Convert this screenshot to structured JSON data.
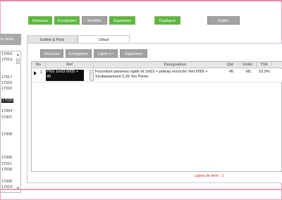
{
  "toolbar": {
    "new_label": "Nouveau",
    "save_label": "Enregistrer",
    "modify_label": "Modifier",
    "delete_label": "Supprimer",
    "duplicate_label": "Dupliquer",
    "edit_label": "Editer"
  },
  "left_panel": {
    "header": "lo devis",
    "items": [
      {
        "label": "17016"
      },
      {
        "label": "17013"
      },
      {
        "label": "17017"
      },
      {
        "label": "17015"
      },
      {
        "label": "17010"
      },
      {
        "label": "17025"
      },
      {
        "label": "17004"
      },
      {
        "label": "17007"
      },
      {
        "label": "17008"
      },
      {
        "label": "17005"
      },
      {
        "label": "17011"
      },
      {
        "label": "17030"
      },
      {
        "label": "17006"
      },
      {
        "label": "17014"
      }
    ],
    "selected": "17025"
  },
  "tabs": [
    {
      "label": "Entête & Pied",
      "active": false
    },
    {
      "label": "Détail",
      "active": true
    }
  ],
  "detail_toolbar": {
    "new_label": "Nouveau",
    "save_label": "Enregistrer",
    "line_label": "Ligne ++",
    "delete_label": "Supprimer"
  },
  "grid": {
    "columns": [
      "No",
      "Ref",
      "Designation",
      "Qté",
      "Unité",
      "TVA"
    ],
    "rows": [
      {
        "no": "1",
        "ref": "PNX 1m53 6005 + 40",
        "designation_line1": "Fourniture panneau rigide ht 1m53 + poteau encoche Vert 6005 +",
        "designation_line2": "Soubassement 0,25 Ton Pierre",
        "qty": "45",
        "unit": "ML",
        "tva": "10,0%"
      }
    ]
  },
  "footer": {
    "lines_count": "Lignes de devis : 1"
  },
  "colors": {
    "accent_green": "#5cb83c",
    "button_grey": "#a3a3a3",
    "footer_red": "#dd2222",
    "frame_pink": "#e08aa2"
  }
}
